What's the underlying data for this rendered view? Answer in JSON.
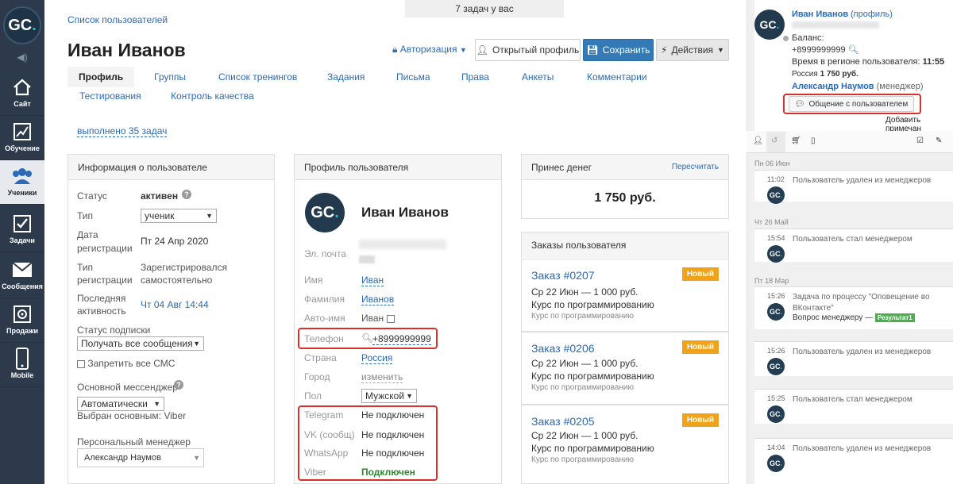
{
  "nav": {
    "logo": {
      "a": "GC",
      "b": "."
    },
    "items": [
      {
        "label": "Сайт",
        "icon": "home-icon"
      },
      {
        "label": "Обучение",
        "icon": "chart-icon"
      },
      {
        "label": "Ученики",
        "icon": "users-icon"
      },
      {
        "label": "Задачи",
        "icon": "checkbox-icon"
      },
      {
        "label": "Сообщения",
        "icon": "envelope-icon"
      },
      {
        "label": "Продажи",
        "icon": "safe-icon"
      },
      {
        "label": "Mobile",
        "icon": "phone-icon"
      }
    ]
  },
  "header": {
    "tasks_bar": "7 задач у вас",
    "breadcrumb": "Список пользователей",
    "title": "Иван Иванов",
    "auth_link": "Авторизация",
    "open_profile": "Открытый профиль",
    "save": "Сохранить",
    "actions": "Действия"
  },
  "tabs": [
    "Профиль",
    "Группы",
    "Список тренингов",
    "Задания",
    "Письма",
    "Права",
    "Анкеты",
    "Комментарии",
    "Тестирования",
    "Контроль качества"
  ],
  "done_tasks": "выполнено 35 задач",
  "user_info": {
    "title": "Информация о пользователе",
    "status_label": "Статус",
    "status_value": "активен",
    "type_label": "Тип",
    "type_value": "ученик",
    "reg_date_label_1": "Дата",
    "reg_date_label_2": "регистрации",
    "reg_date_value": "Пт 24 Апр 2020",
    "reg_type_label_1": "Тип",
    "reg_type_label_2": "регистрации",
    "reg_type_value_1": "Зарегистрировался",
    "reg_type_value_2": "самостоятельно",
    "last_activity_label_1": "Последняя",
    "last_activity_label_2": "активность",
    "last_activity_value": "Чт 04 Авг 14:44",
    "subscription_label": "Статус подписки",
    "subscription_value": "Получать все сообщения",
    "no_sms": "Запретить все СМС",
    "messenger_label": "Основной мессенджер",
    "messenger_value": "Автоматически",
    "messenger_chosen": "Выбран основным: Viber",
    "manager_label": "Персональный менеджер",
    "manager_value": "Александр Наумов"
  },
  "profile": {
    "title": "Профиль пользователя",
    "name": "Иван Иванов",
    "email_label": "Эл. почта",
    "first_name_label": "Имя",
    "first_name": "Иван",
    "last_name_label": "Фамилия",
    "last_name": "Иванов",
    "auto_name_label": "Авто-имя",
    "auto_name": "Иван",
    "phone_label": "Телефон",
    "phone": "+8999999999",
    "country_label": "Страна",
    "country": "Россия",
    "city_label": "Город",
    "city": "изменить",
    "gender_label": "Пол",
    "gender": "Мужской",
    "messengers": [
      {
        "label": "Telegram",
        "value": "Не подключен"
      },
      {
        "label": "VK (сообщ)",
        "value": "Не подключен"
      },
      {
        "label": "WhatsApp",
        "value": "Не подключен"
      },
      {
        "label": "Viber",
        "value": "Подключен"
      }
    ]
  },
  "money": {
    "title": "Принес денег",
    "recalc": "Пересчитать",
    "amount": "1 750 руб."
  },
  "orders": {
    "title": "Заказы пользователя",
    "items": [
      {
        "number": "Заказ #0207",
        "badge": "Новый",
        "line1": "Ср 22 Июн — 1 000 руб.",
        "line2": "Курс по программированию",
        "line3": "Курс по программированию"
      },
      {
        "number": "Заказ #0206",
        "badge": "Новый",
        "line1": "Ср 22 Июн — 1 000 руб.",
        "line2": "Курс по программированию",
        "line3": "Курс по программированию"
      },
      {
        "number": "Заказ #0205",
        "badge": "Новый",
        "line1": "Ср 22 Июн — 1 000 руб.",
        "line2": "Курс по программированию",
        "line3": "Курс по программированию"
      }
    ]
  },
  "right": {
    "name": "Иван Иванов",
    "profile_link": "(профиль)",
    "balance_label": "Баланс:",
    "phone": "+8999999999",
    "time_label": "Время в регионе пользователя:",
    "time_value": "11:55",
    "money_prefix": "Россия",
    "money_value": "1 750 руб.",
    "manager_name": "Александр Наумов",
    "manager_role": "(менеджер)",
    "chat_button": "Общение с пользователем",
    "add_note": "Добавить примечан",
    "feed": [
      {
        "date": "Пн 06 Июн",
        "time": "11:02",
        "text": "Пользователь удален из менеджеров"
      },
      {
        "date": "Чт 26 Май",
        "time": "15:54",
        "text": "Пользователь стал менеджером"
      },
      {
        "date": "Пт 18 Мар",
        "time": "15:26",
        "text": "Задача по процессу \"Оповещение во ВКонтакте\"",
        "extra": "Вопрос менеджеру —",
        "badge": "Результат1"
      },
      {
        "date": "",
        "time": "15:26",
        "text": "Пользователь удален из менеджеров"
      },
      {
        "date": "",
        "time": "15:25",
        "text": "Пользователь стал менеджером"
      },
      {
        "date": "",
        "time": "14:04",
        "text": "Пользователь удален из менеджеров"
      }
    ]
  }
}
